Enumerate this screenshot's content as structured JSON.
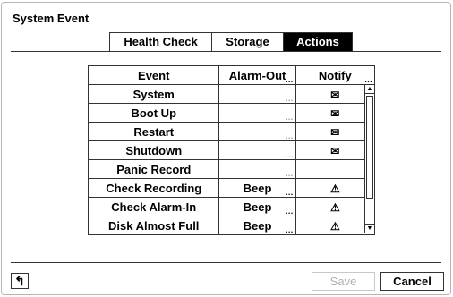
{
  "dialog": {
    "title": "System Event"
  },
  "tabs": [
    {
      "label": "Health Check",
      "active": false
    },
    {
      "label": "Storage",
      "active": false
    },
    {
      "label": "Actions",
      "active": true
    }
  ],
  "table": {
    "headers": {
      "event": "Event",
      "alarm_out": "Alarm-Out",
      "notify": "Notify"
    },
    "rows": [
      {
        "event": "System",
        "alarm_out": "",
        "notify_icon": "✉"
      },
      {
        "event": "Boot Up",
        "alarm_out": "",
        "notify_icon": "✉"
      },
      {
        "event": "Restart",
        "alarm_out": "",
        "notify_icon": "✉"
      },
      {
        "event": "Shutdown",
        "alarm_out": "",
        "notify_icon": "✉"
      },
      {
        "event": "Panic Record",
        "alarm_out": "",
        "notify_icon": ""
      },
      {
        "event": "Check Recording",
        "alarm_out": "Beep",
        "notify_icon": "⚠"
      },
      {
        "event": "Check Alarm-In",
        "alarm_out": "Beep",
        "notify_icon": "⚠"
      },
      {
        "event": "Disk Almost Full",
        "alarm_out": "Beep",
        "notify_icon": "⚠"
      }
    ],
    "more_glyph": "…"
  },
  "footer": {
    "back_glyph": "↰",
    "save_label": "Save",
    "cancel_label": "Cancel"
  },
  "scrollbar": {
    "up_glyph": "▲",
    "down_glyph": "▼"
  }
}
